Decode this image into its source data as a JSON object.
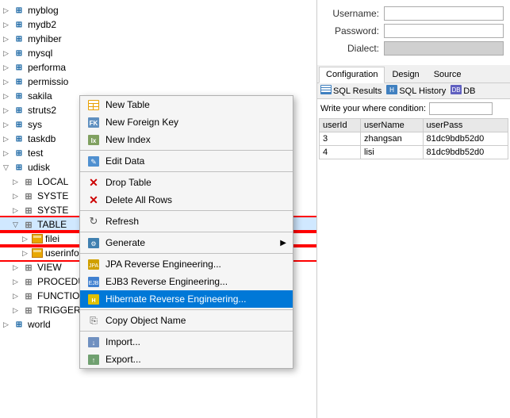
{
  "leftPanel": {
    "treeItems": [
      {
        "id": "myblog",
        "label": "myblog",
        "indent": 0,
        "expanded": false,
        "type": "db"
      },
      {
        "id": "mydb2",
        "label": "mydb2",
        "indent": 0,
        "expanded": false,
        "type": "db"
      },
      {
        "id": "myhiber",
        "label": "myhiber",
        "indent": 0,
        "expanded": false,
        "type": "db"
      },
      {
        "id": "mysql",
        "label": "mysql",
        "indent": 0,
        "expanded": false,
        "type": "db"
      },
      {
        "id": "performa",
        "label": "performa",
        "indent": 0,
        "expanded": false,
        "type": "db"
      },
      {
        "id": "permissio",
        "label": "permissio",
        "indent": 0,
        "expanded": false,
        "type": "db"
      },
      {
        "id": "sakila",
        "label": "sakila",
        "indent": 0,
        "expanded": false,
        "type": "db"
      },
      {
        "id": "struts2",
        "label": "struts2",
        "indent": 0,
        "expanded": false,
        "type": "db"
      },
      {
        "id": "sys",
        "label": "sys",
        "indent": 0,
        "expanded": false,
        "type": "db"
      },
      {
        "id": "taskdb",
        "label": "taskdb",
        "indent": 0,
        "expanded": false,
        "type": "db"
      },
      {
        "id": "test",
        "label": "test",
        "indent": 0,
        "expanded": false,
        "type": "db"
      },
      {
        "id": "udisk",
        "label": "udisk",
        "indent": 0,
        "expanded": true,
        "type": "db"
      },
      {
        "id": "LOCAL",
        "label": "LOCAL",
        "indent": 1,
        "expanded": false,
        "type": "folder"
      },
      {
        "id": "SYSTE1",
        "label": "SYSTE",
        "indent": 1,
        "expanded": false,
        "type": "folder"
      },
      {
        "id": "SYSTE2",
        "label": "SYSTE",
        "indent": 1,
        "expanded": false,
        "type": "folder"
      },
      {
        "id": "TABLE",
        "label": "TABLE",
        "indent": 1,
        "expanded": true,
        "type": "folder",
        "highlight": true
      },
      {
        "id": "filei",
        "label": "filei",
        "indent": 2,
        "expanded": false,
        "type": "table",
        "highlight": true
      },
      {
        "id": "userinfo",
        "label": "userinfo",
        "indent": 2,
        "expanded": false,
        "type": "table",
        "highlight": true
      },
      {
        "id": "VIEW",
        "label": "VIEW",
        "indent": 1,
        "expanded": false,
        "type": "folder"
      },
      {
        "id": "PROCEDURE",
        "label": "PROCEDURE",
        "indent": 1,
        "expanded": false,
        "type": "folder"
      },
      {
        "id": "FUNCTION",
        "label": "FUNCTION",
        "indent": 1,
        "expanded": false,
        "type": "folder"
      },
      {
        "id": "TRIGGER",
        "label": "TRIGGER",
        "indent": 1,
        "expanded": false,
        "type": "folder"
      },
      {
        "id": "world",
        "label": "world",
        "indent": 0,
        "expanded": false,
        "type": "db"
      }
    ]
  },
  "contextMenu": {
    "items": [
      {
        "id": "new-table",
        "label": "New Table",
        "icon": "table",
        "type": "item"
      },
      {
        "id": "new-fk",
        "label": "New Foreign Key",
        "icon": "fk",
        "type": "item"
      },
      {
        "id": "new-index",
        "label": "New Index",
        "icon": "index",
        "type": "item"
      },
      {
        "id": "sep1",
        "type": "separator"
      },
      {
        "id": "edit-data",
        "label": "Edit Data",
        "icon": "edit",
        "type": "item"
      },
      {
        "id": "sep2",
        "type": "separator"
      },
      {
        "id": "drop-table",
        "label": "Drop Table",
        "icon": "x",
        "type": "item"
      },
      {
        "id": "delete-rows",
        "label": "Delete All Rows",
        "icon": "x",
        "type": "item"
      },
      {
        "id": "sep3",
        "type": "separator"
      },
      {
        "id": "refresh",
        "label": "Refresh",
        "icon": "refresh",
        "type": "item"
      },
      {
        "id": "sep4",
        "type": "separator"
      },
      {
        "id": "generate",
        "label": "Generate",
        "icon": "gen",
        "type": "item",
        "hasArrow": true
      },
      {
        "id": "sep5",
        "type": "separator"
      },
      {
        "id": "jpa-reverse",
        "label": "JPA Reverse Engineering...",
        "icon": "jpa",
        "type": "item"
      },
      {
        "id": "ejb3-reverse",
        "label": "EJB3 Reverse Engineering...",
        "icon": "ejb",
        "type": "item"
      },
      {
        "id": "hibernate-reverse",
        "label": "Hibernate Reverse Engineering...",
        "icon": "hib",
        "type": "item",
        "highlighted": true
      },
      {
        "id": "sep6",
        "type": "separator"
      },
      {
        "id": "copy-name",
        "label": "Copy Object Name",
        "icon": "copy",
        "type": "item"
      },
      {
        "id": "sep7",
        "type": "separator"
      },
      {
        "id": "import",
        "label": "Import...",
        "icon": "imp",
        "type": "item"
      },
      {
        "id": "export",
        "label": "Export...",
        "icon": "exp",
        "type": "item"
      }
    ]
  },
  "rightPanel": {
    "form": {
      "usernameLabel": "Username:",
      "passwordLabel": "Password:",
      "dialectLabel": "Dialect:",
      "usernameValue": "",
      "passwordValue": "",
      "dialectValue": ""
    },
    "tabs": [
      "Configuration",
      "Design",
      "Source"
    ],
    "activeTab": "Configuration",
    "sqlToolbar": {
      "resultsLabel": "SQL Results",
      "historyLabel": "SQL History",
      "dbLabel": "DB"
    },
    "whereLabel": "Write your where condition:",
    "tableHeaders": [
      "userId",
      "userName",
      "userPass"
    ],
    "tableRows": [
      {
        "userId": "3",
        "userName": "zhangsan",
        "userPass": "81dc9bdb52d0"
      },
      {
        "userId": "4",
        "userName": "lisi",
        "userPass": "81dc9bdb52d0"
      }
    ]
  }
}
